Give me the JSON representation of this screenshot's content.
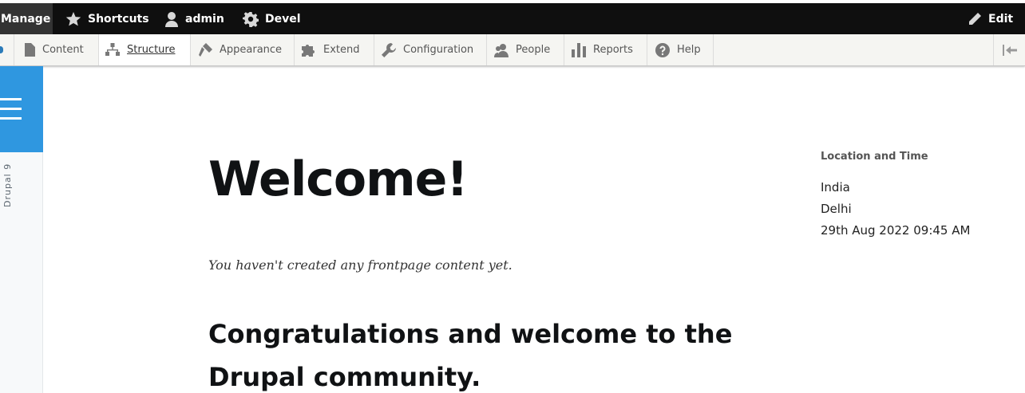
{
  "toolbar": {
    "manage": "Manage",
    "shortcuts": "Shortcuts",
    "user": "admin",
    "devel": "Devel",
    "edit": "Edit"
  },
  "tray": {
    "items": [
      "Content",
      "Structure",
      "Appearance",
      "Extend",
      "Configuration",
      "People",
      "Reports",
      "Help"
    ],
    "active": "Structure"
  },
  "sidebar": {
    "site_name": "Drupal 9"
  },
  "main": {
    "title": "Welcome!",
    "empty_message": "You haven't created any frontpage content yet.",
    "heading": "Congratulations and welcome to the Drupal community."
  },
  "block": {
    "title": "Location and Time",
    "country": "India",
    "city": "Delhi",
    "datetime": "29th Aug 2022 09:45 AM"
  },
  "colors": {
    "toolbar_bg": "#0f0f0f",
    "accent": "#2f97e0"
  }
}
